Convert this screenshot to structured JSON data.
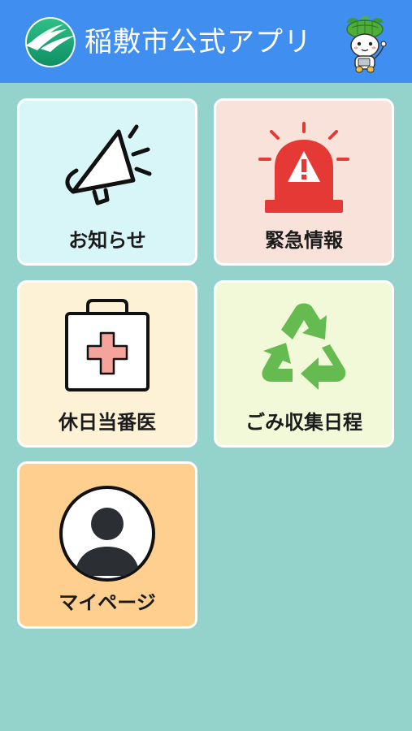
{
  "header": {
    "title": "稲敷市公式アプリ",
    "logo_icon": "city-emblem-icon",
    "mascot_icon": "city-mascot-icon",
    "background_color": "#3f8ef0"
  },
  "menu": {
    "background_color": "#93d3cc",
    "tiles": [
      {
        "label": "お知らせ",
        "icon": "megaphone-icon",
        "background_color": "#d8f5f7"
      },
      {
        "label": "緊急情報",
        "icon": "emergency-siren-icon",
        "background_color": "#f8e2da"
      },
      {
        "label": "休日当番医",
        "icon": "first-aid-kit-icon",
        "background_color": "#fdf2d5"
      },
      {
        "label": "ごみ収集日程",
        "icon": "recycle-icon",
        "background_color": "#f1f9d9"
      },
      {
        "label": "マイページ",
        "icon": "user-avatar-icon",
        "background_color": "#fecf8e"
      }
    ]
  }
}
